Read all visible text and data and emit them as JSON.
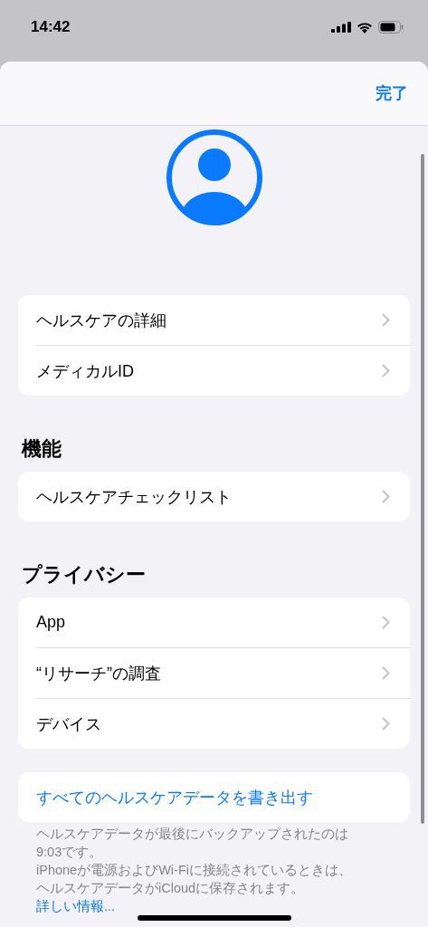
{
  "status_bar": {
    "time": "14:42"
  },
  "nav": {
    "done": "完了"
  },
  "groups": [
    {
      "items": [
        {
          "label": "ヘルスケアの詳細"
        },
        {
          "label": "メディカルID"
        }
      ]
    },
    {
      "header": "機能",
      "items": [
        {
          "label": "ヘルスケアチェックリスト"
        }
      ]
    },
    {
      "header": "プライバシー",
      "items": [
        {
          "label": "App"
        },
        {
          "label": "“リサーチ”の調査"
        },
        {
          "label": "デバイス"
        }
      ]
    }
  ],
  "export_button": "すべてのヘルスケアデータを書き出す",
  "footer": {
    "lines": [
      "ヘルスケアデータが最後にバックアップされたのは9:03です。",
      "iPhoneが電源およびWi-Fiに接続されているときは、ヘルスケアデータがiCloudに保存されます。"
    ],
    "link": "詳しい情報..."
  }
}
